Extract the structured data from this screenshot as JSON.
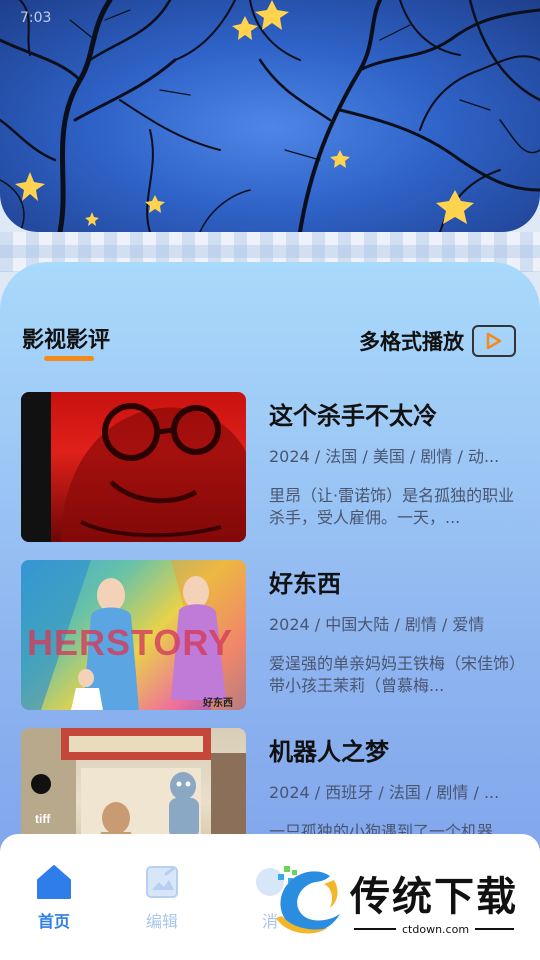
{
  "status_bar": {
    "time": "7:03"
  },
  "section": {
    "title": "影视影评",
    "multi_format_label": "多格式播放",
    "play_icon": "play-icon"
  },
  "movies": [
    {
      "title": "这个杀手不太冷",
      "meta": "2024 / 法国 / 美国 / 剧情 / 动...",
      "desc": "里昂（让·雷诺饰）是名孤独的职业杀手，受人雇佣。一天，..."
    },
    {
      "title": "好东西",
      "meta": "2024 / 中国大陆 / 剧情 / 爱情",
      "desc": "爱逞强的单亲妈妈王铁梅（宋佳饰）带小孩王茉莉（曾慕梅...",
      "poster_text": "HERSTORY",
      "poster_small": "好东西"
    },
    {
      "title": "机器人之梦",
      "meta": "2024 / 西班牙 / 法国 / 剧情 / ...",
      "desc": "一只孤独的小狗遇到了一个机器人...",
      "poster_text": "tiff"
    }
  ],
  "nav": {
    "items": [
      {
        "label": "首页",
        "icon": "home-icon",
        "active": true
      },
      {
        "label": "编辑",
        "icon": "image-edit-icon",
        "active": false
      },
      {
        "label": "消",
        "icon": "nav-icon",
        "active": false
      }
    ]
  },
  "watermark": {
    "text": "传统下载",
    "url": "ctdown.com"
  },
  "colors": {
    "accent_orange": "#f38a1a",
    "nav_active": "#2f7de9",
    "panel_top": "#a9d9fb",
    "panel_bottom": "#7ea3ec"
  }
}
